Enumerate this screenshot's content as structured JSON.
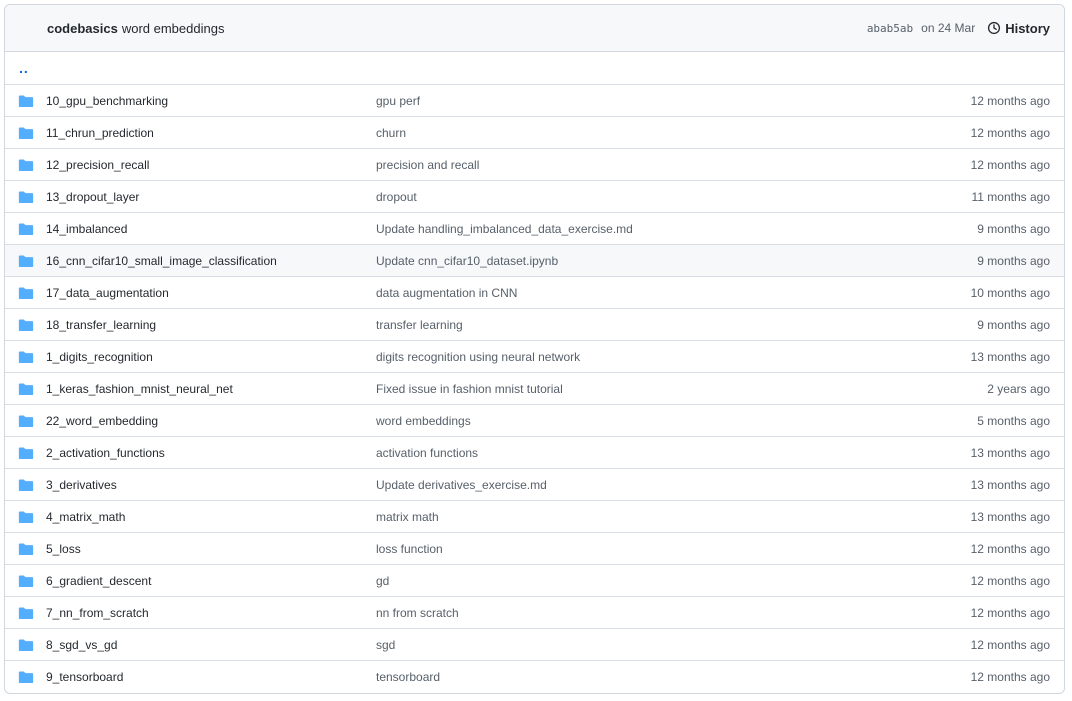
{
  "header": {
    "owner": "codebasics",
    "message": "word embeddings",
    "sha": "abab5ab",
    "date": "on 24 Mar",
    "history_label": "History"
  },
  "parent_dir": "..",
  "rows": [
    {
      "name": "10_gpu_benchmarking",
      "commit": "gpu perf",
      "age": "12 months ago"
    },
    {
      "name": "11_chrun_prediction",
      "commit": "churn",
      "age": "12 months ago"
    },
    {
      "name": "12_precision_recall",
      "commit": "precision and recall",
      "age": "12 months ago"
    },
    {
      "name": "13_dropout_layer",
      "commit": "dropout",
      "age": "11 months ago"
    },
    {
      "name": "14_imbalanced",
      "commit": "Update handling_imbalanced_data_exercise.md",
      "age": "9 months ago"
    },
    {
      "name": "16_cnn_cifar10_small_image_classification",
      "commit": "Update cnn_cifar10_dataset.ipynb",
      "age": "9 months ago"
    },
    {
      "name": "17_data_augmentation",
      "commit": "data augmentation in CNN",
      "age": "10 months ago"
    },
    {
      "name": "18_transfer_learning",
      "commit": "transfer learning",
      "age": "9 months ago"
    },
    {
      "name": "1_digits_recognition",
      "commit": "digits recognition using neural network",
      "age": "13 months ago"
    },
    {
      "name": "1_keras_fashion_mnist_neural_net",
      "commit": "Fixed issue in fashion mnist tutorial",
      "age": "2 years ago"
    },
    {
      "name": "22_word_embedding",
      "commit": "word embeddings",
      "age": "5 months ago"
    },
    {
      "name": "2_activation_functions",
      "commit": "activation functions",
      "age": "13 months ago"
    },
    {
      "name": "3_derivatives",
      "commit": "Update derivatives_exercise.md",
      "age": "13 months ago"
    },
    {
      "name": "4_matrix_math",
      "commit": "matrix math",
      "age": "13 months ago"
    },
    {
      "name": "5_loss",
      "commit": "loss function",
      "age": "12 months ago"
    },
    {
      "name": "6_gradient_descent",
      "commit": "gd",
      "age": "12 months ago"
    },
    {
      "name": "7_nn_from_scratch",
      "commit": "nn from scratch",
      "age": "12 months ago"
    },
    {
      "name": "8_sgd_vs_gd",
      "commit": "sgd",
      "age": "12 months ago"
    },
    {
      "name": "9_tensorboard",
      "commit": "tensorboard",
      "age": "12 months ago"
    }
  ],
  "icons": {
    "folder": "folder-icon",
    "history": "history-icon"
  },
  "colors": {
    "folder": "#54aeff",
    "link": "#0969da",
    "muted": "#57606a"
  }
}
